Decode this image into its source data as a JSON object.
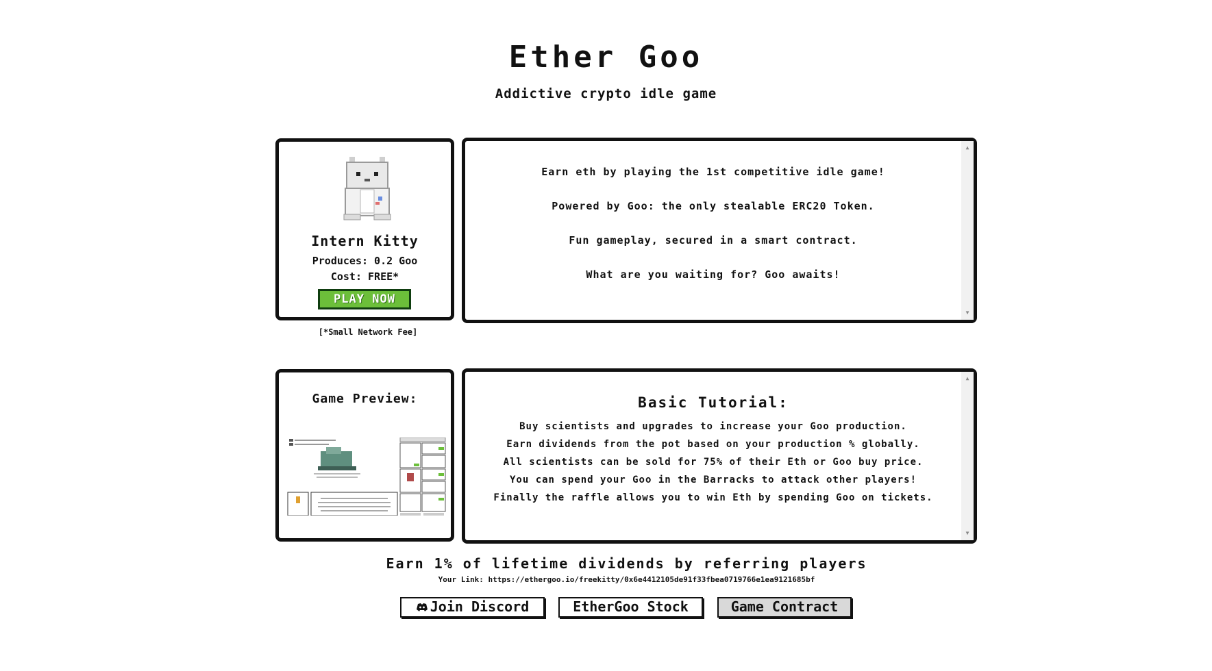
{
  "header": {
    "title": "Ether Goo",
    "subtitle": "Addictive crypto idle game"
  },
  "kitty_card": {
    "image_icon": "kitty-icon",
    "name": "Intern Kitty",
    "produces": "Produces: 0.2 Goo",
    "cost": "Cost: FREE*",
    "play_label": "PLAY NOW",
    "network_fee": "[*Small Network Fee]",
    "play_color": "#6cbf3a"
  },
  "intro": {
    "lines": [
      "Earn eth by playing the 1st competitive idle game!",
      "Powered by Goo: the only stealable ERC20 Token.",
      "Fun gameplay, secured in a smart contract.",
      "What are you waiting for? Goo awaits!"
    ]
  },
  "preview": {
    "title": "Game Preview:"
  },
  "tutorial": {
    "title": "Basic Tutorial:",
    "lines": [
      "Buy scientists and upgrades to increase your Goo production.",
      "Earn dividends from the pot based on your production % globally.",
      "All scientists can be sold for 75% of their Eth or Goo buy price.",
      "You can spend your Goo in the Barracks to attack other players!",
      "Finally the raffle allows you to win Eth by spending Goo on tickets."
    ]
  },
  "referral": {
    "title": "Earn 1% of lifetime dividends by referring players",
    "link": "Your Link: https://ethergoo.io/freekitty/0x6e4412105de91f33fbea0719766e1ea9121685bf"
  },
  "buttons": {
    "discord_label": "Join Discord",
    "discord_icon": "discord-icon",
    "stock_label": "EtherGoo Stock",
    "contract_label": "Game Contract"
  }
}
